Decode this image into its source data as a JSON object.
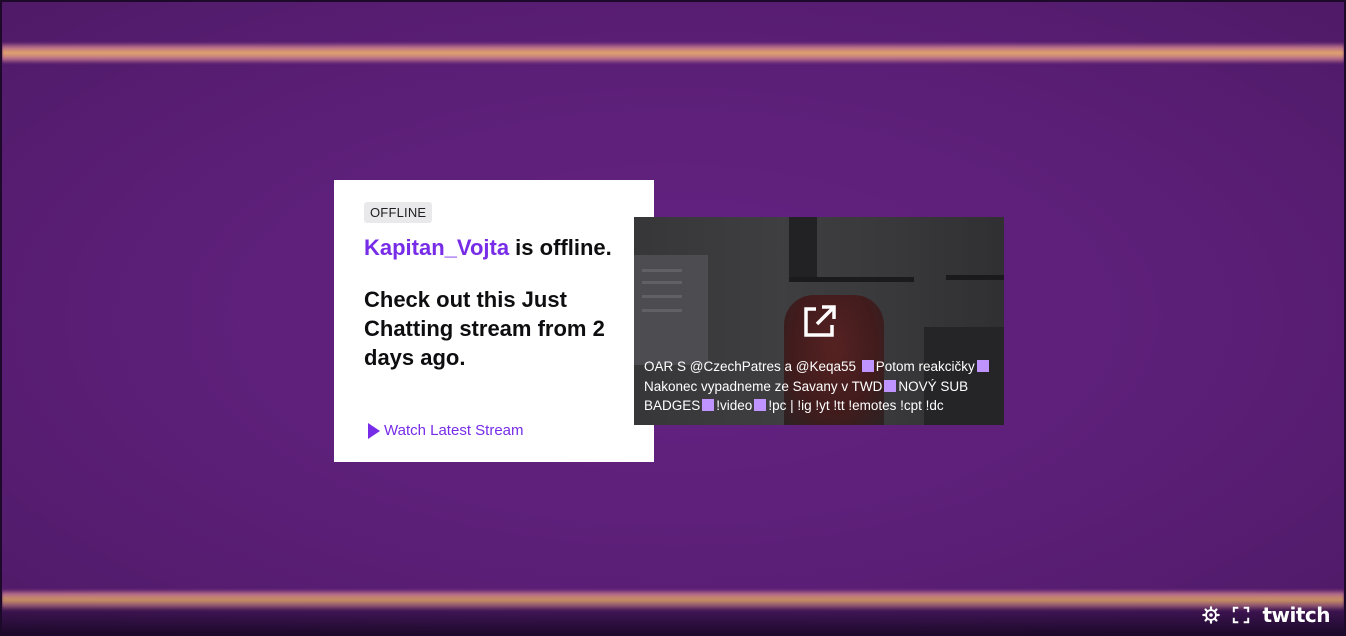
{
  "offline_card": {
    "badge": "OFFLINE",
    "channel_name": "Kapitan_Vojta",
    "offline_suffix": " is offline.",
    "subtitle": "Check out this Just Chatting stream from 2 days ago.",
    "watch_link": "Watch Latest Stream"
  },
  "vod_thumbnail": {
    "title_parts": [
      "OAR S @CzechPatres a @Keqa55 ",
      "Potom reakcičky",
      "Nakonec vypadneme ze Savany v TWD",
      "NOVÝ SUB BADGES",
      "!video",
      "!pc | !ig !yt !tt !emotes !cpt !dc"
    ],
    "icon": "external-link-icon"
  },
  "player_controls": {
    "settings_icon": "gear-icon",
    "fullscreen_icon": "fullscreen-icon",
    "logo": "twitch"
  },
  "colors": {
    "accent": "#772ce8",
    "background": "#5e2078",
    "emote": "#bf94ff"
  }
}
